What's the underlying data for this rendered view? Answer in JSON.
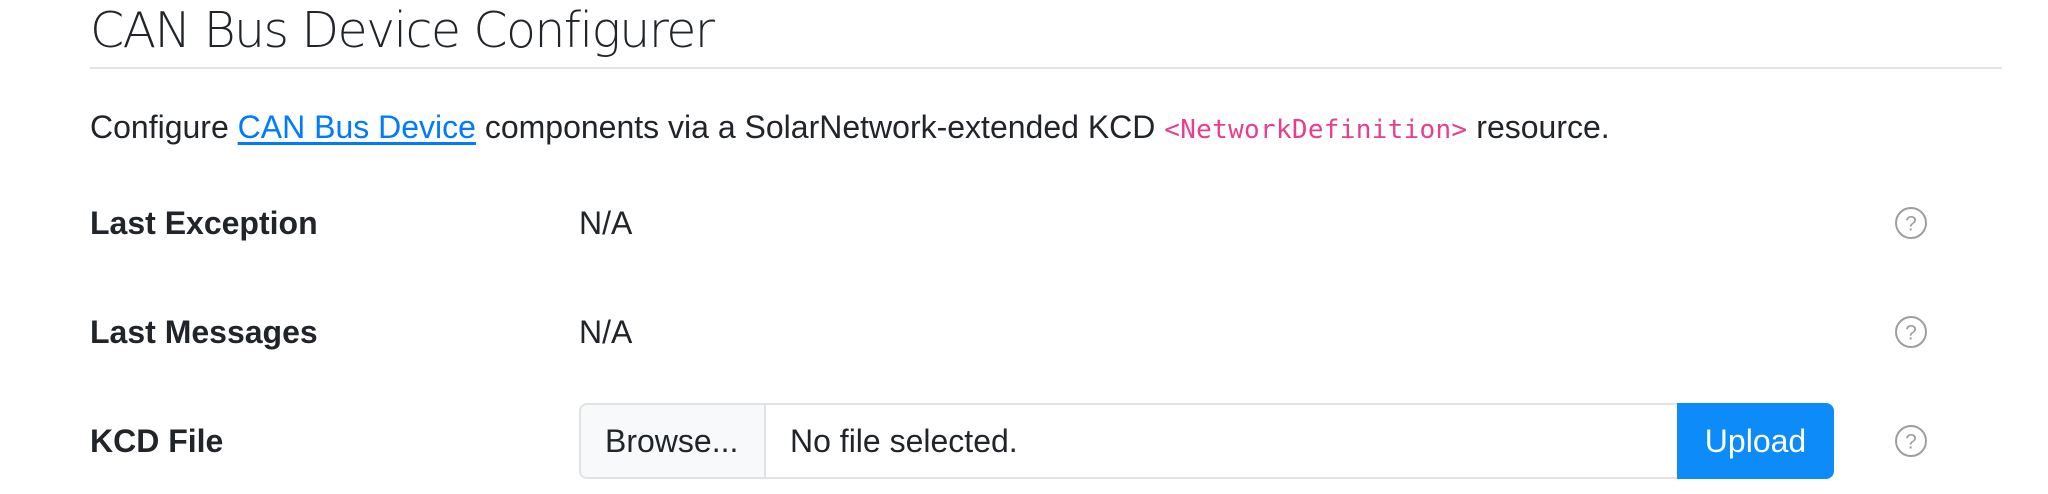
{
  "page": {
    "title": "CAN Bus Device Configurer"
  },
  "intro": {
    "prefix": "Configure ",
    "link_text": "CAN Bus Device",
    "middle": " components via a SolarNetwork-extended KCD ",
    "code_text": "<NetworkDefinition>",
    "suffix": " resource."
  },
  "rows": [
    {
      "label": "Last Exception",
      "value": "N/A",
      "help_icon": "question-circle-icon"
    },
    {
      "label": "Last Messages",
      "value": "N/A",
      "help_icon": "question-circle-icon"
    },
    {
      "label": "KCD File",
      "help_icon": "question-circle-icon"
    }
  ],
  "kcd_file": {
    "browse_label": "Browse...",
    "status_text": "No file selected.",
    "upload_label": "Upload"
  },
  "colors": {
    "link": "#007bff",
    "code": "#e83e8c",
    "upload_button": "#0d8bf8",
    "help_icon": "#9e9e9e"
  }
}
